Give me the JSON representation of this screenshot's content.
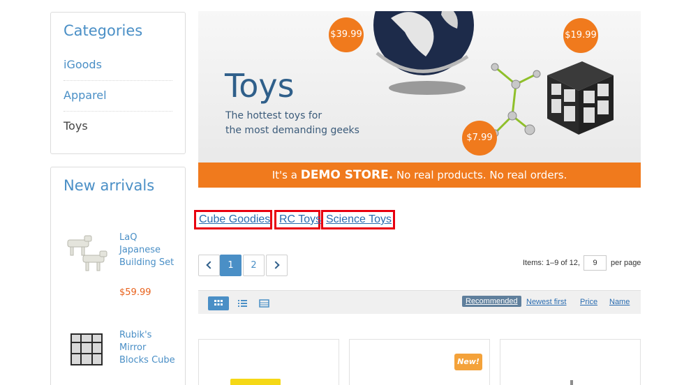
{
  "sidebar": {
    "categories_title": "Categories",
    "categories": [
      {
        "label": "iGoods"
      },
      {
        "label": "Apparel"
      },
      {
        "label": "Toys"
      }
    ],
    "new_arrivals_title": "New arrivals",
    "new_arrivals": [
      {
        "name": "LaQ Japanese Building Set",
        "price": "$59.99"
      },
      {
        "name": "Rubik's Mirror Blocks Cube",
        "price": ""
      }
    ]
  },
  "banner": {
    "title": "Toys",
    "subtitle_line1": "The hottest toys for",
    "subtitle_line2": "the most demanding geeks",
    "strip_prefix": "It's a",
    "strip_bold": "DEMO STORE.",
    "strip_suffix": "No real products. No real orders.",
    "prices": [
      "$39.99",
      "$19.99",
      "$7.99"
    ]
  },
  "subcategories": [
    "Cube Goodies",
    "RC Toys",
    "Science Toys"
  ],
  "pagination": {
    "pages": [
      "1",
      "2"
    ],
    "current": "1",
    "items_info": "Items: 1–9 of 12,",
    "per_page_value": "9",
    "per_page_label": "per page"
  },
  "sort": {
    "options": [
      "Recommended",
      "Newest first",
      "Price",
      "Name"
    ],
    "active": "Recommended"
  },
  "products": {
    "new_badge": "New!"
  },
  "colors": {
    "accent": "#4a8fc6",
    "orange": "#f07a1d",
    "highlight_border": "#e8000f"
  }
}
